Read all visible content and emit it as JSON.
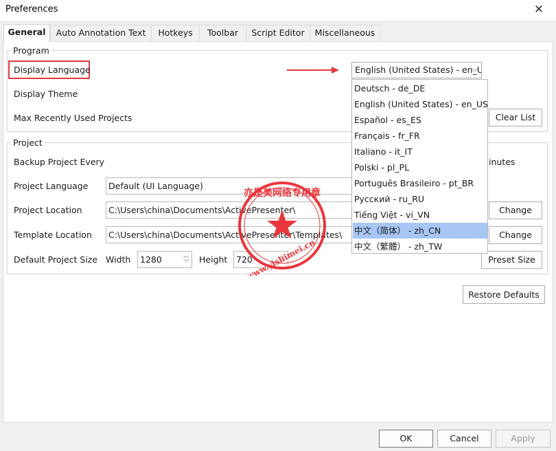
{
  "window": {
    "title": "Preferences",
    "close_glyph": "✕"
  },
  "tabs": [
    {
      "label": "General"
    },
    {
      "label": "Auto Annotation Text"
    },
    {
      "label": "Hotkeys"
    },
    {
      "label": "Toolbar"
    },
    {
      "label": "Script Editor"
    },
    {
      "label": "Miscellaneous"
    }
  ],
  "program": {
    "group_label": "Program",
    "display_language_label": "Display Language",
    "display_theme_label": "Display Theme",
    "max_recent_label": "Max Recently Used Projects",
    "clear_list_label": "Clear List",
    "language_select_value": "English (United States) - en_U"
  },
  "project": {
    "group_label": "Project",
    "backup_label": "Backup Project Every",
    "backup_suffix": "inutes",
    "project_language_label": "Project Language",
    "project_language_value": "Default (UI Language)",
    "project_location_label": "Project Location",
    "project_location_value": "C:\\Users\\china\\Documents\\ActivePresenter\\",
    "template_location_label": "Template Location",
    "template_location_value": "C:\\Users\\china\\Documents\\ActivePresenter\\Templates\\",
    "change_label": "Change",
    "default_size_label": "Default Project Size",
    "width_label": "Width",
    "width_value": "1280",
    "height_label": "Height",
    "height_value": "720",
    "preset_label": "Preset Size"
  },
  "language_options": [
    {
      "label": "Deutsch - de_DE"
    },
    {
      "label": "English (United States) - en_US"
    },
    {
      "label": "Español - es_ES"
    },
    {
      "label": "Français - fr_FR"
    },
    {
      "label": "Italiano - it_IT"
    },
    {
      "label": "Polski - pl_PL"
    },
    {
      "label": "Português Brasileiro - pt_BR"
    },
    {
      "label": "Русский - ru_RU"
    },
    {
      "label": "Tiếng Việt - vi_VN"
    },
    {
      "label": "中文（简体） - zh_CN",
      "selected": true
    },
    {
      "label": "中文（繁體） - zh_TW"
    }
  ],
  "restore_defaults_label": "Restore Defaults",
  "footer": {
    "ok_label": "OK",
    "cancel_label": "Cancel",
    "apply_label": "Apply"
  },
  "watermark": {
    "text": "亦是美网络专用章",
    "url": "www.yishimei.cn"
  },
  "colors": {
    "annotation_red": "#e0393e",
    "selection_blue": "#a8c6f5",
    "stamp_red": "#e8262d"
  }
}
